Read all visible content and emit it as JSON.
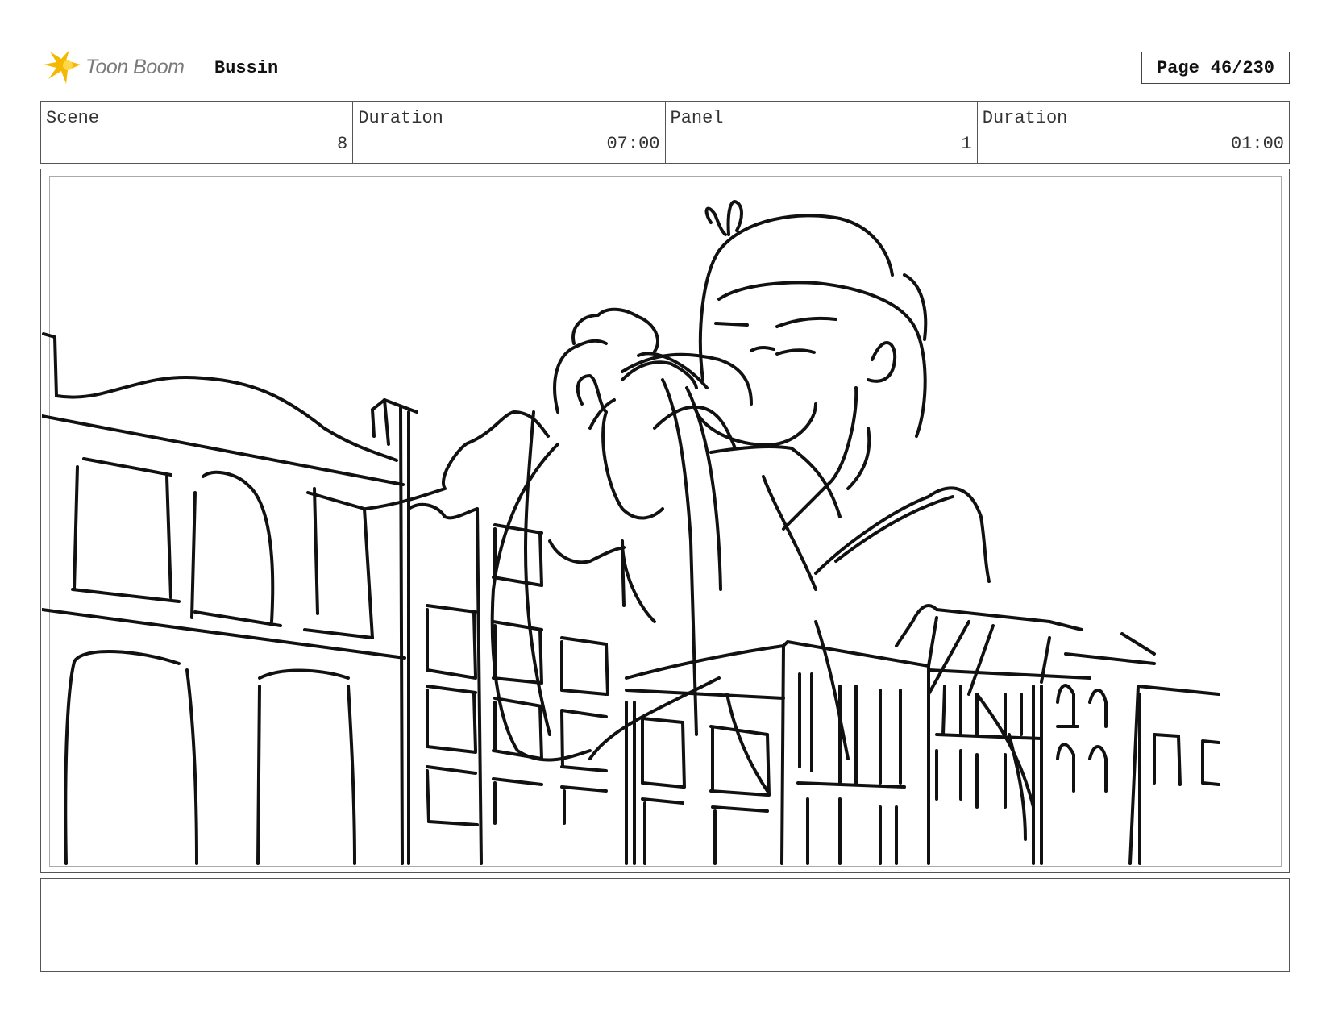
{
  "header": {
    "logo_text": "Toon Boom",
    "logo_icon": "starburst-icon",
    "project": "Bussin",
    "page_label": "Page",
    "page_value": "46/230"
  },
  "info": {
    "scene_label": "Scene",
    "scene_value": "8",
    "scene_duration_label": "Duration",
    "scene_duration_value": "07:00",
    "panel_label": "Panel",
    "panel_value": "1",
    "panel_duration_label": "Duration",
    "panel_duration_value": "01:00"
  },
  "notes": {
    "text": ""
  },
  "colors": {
    "logo_accent": "#f5b800",
    "ink": "#111111",
    "border": "#555555"
  }
}
